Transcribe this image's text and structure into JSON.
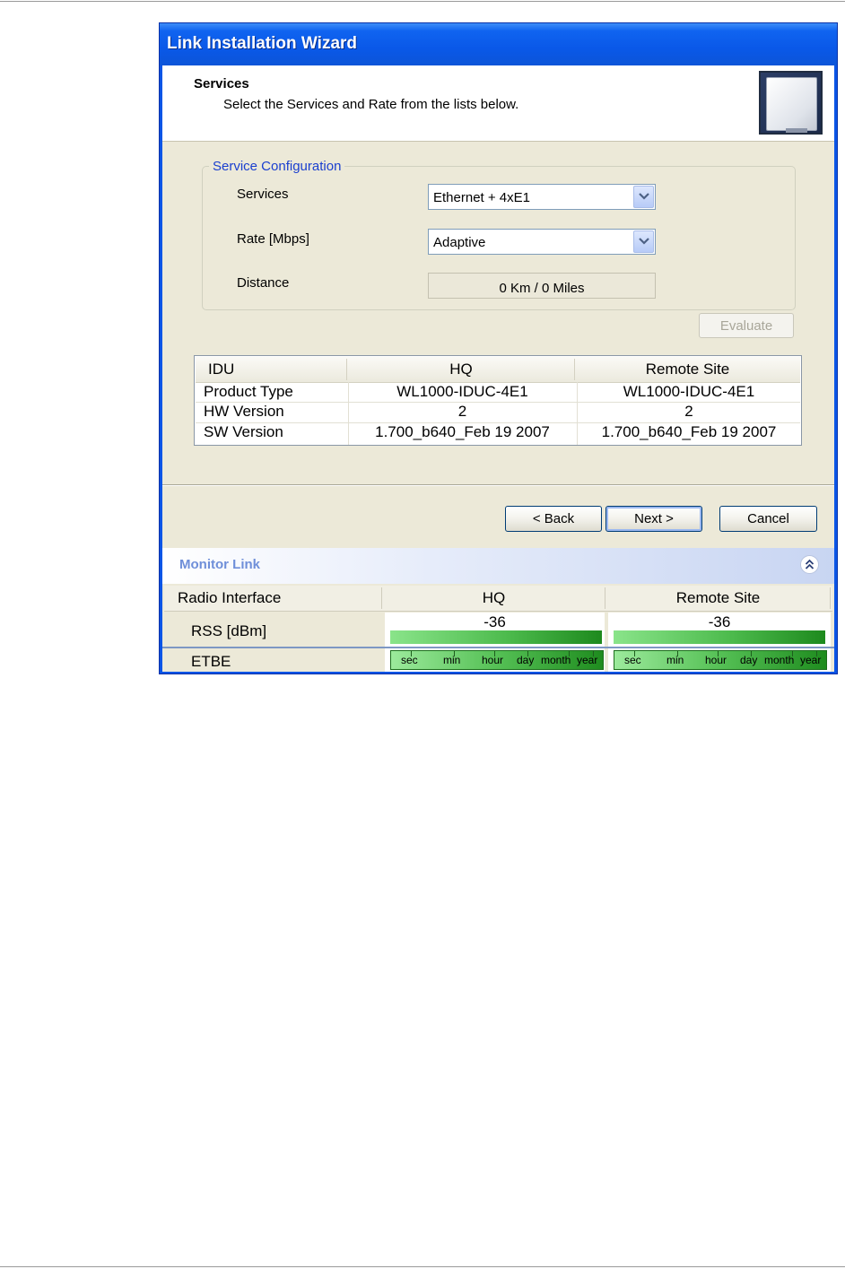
{
  "window": {
    "title": "Link Installation Wizard"
  },
  "header": {
    "title": "Services",
    "subtitle": "Select the Services and Rate from the lists below."
  },
  "service_config": {
    "legend": "Service Configuration",
    "services_label": "Services",
    "services_value": "Ethernet + 4xE1",
    "rate_label": "Rate [Mbps]",
    "rate_value": "Adaptive",
    "distance_label": "Distance",
    "distance_value": "0 Km / 0 Miles",
    "evaluate_label": "Evaluate"
  },
  "idu_table": {
    "columns": [
      "IDU",
      "HQ",
      "Remote Site"
    ],
    "rows": [
      [
        "Product Type",
        "WL1000-IDUC-4E1",
        "WL1000-IDUC-4E1"
      ],
      [
        "HW Version",
        "2",
        "2"
      ],
      [
        "SW Version",
        "1.700_b640_Feb 19 2007",
        "1.700_b640_Feb 19 2007"
      ]
    ]
  },
  "nav": {
    "back_label": "< Back",
    "next_label": "Next >",
    "cancel_label": "Cancel"
  },
  "monitor": {
    "title": "Monitor Link",
    "columns": [
      "Radio Interface",
      "HQ",
      "Remote Site"
    ],
    "rss_label": "RSS [dBm]",
    "rss_hq": "-36",
    "rss_remote": "-36",
    "etbe_label": "ETBE",
    "etbe_scale": [
      "sec",
      "min",
      "hour",
      "day",
      "month",
      "year"
    ]
  },
  "colors": {
    "titlebar": "#0a58e8",
    "legend": "#1a3fcf",
    "bar_green": "#2e9a2e",
    "monitor_title": "#6f8fd9"
  },
  "icons": [
    "dropdown-arrow-icon",
    "collapse-chevron-icon",
    "antenna-panel-icon"
  ]
}
